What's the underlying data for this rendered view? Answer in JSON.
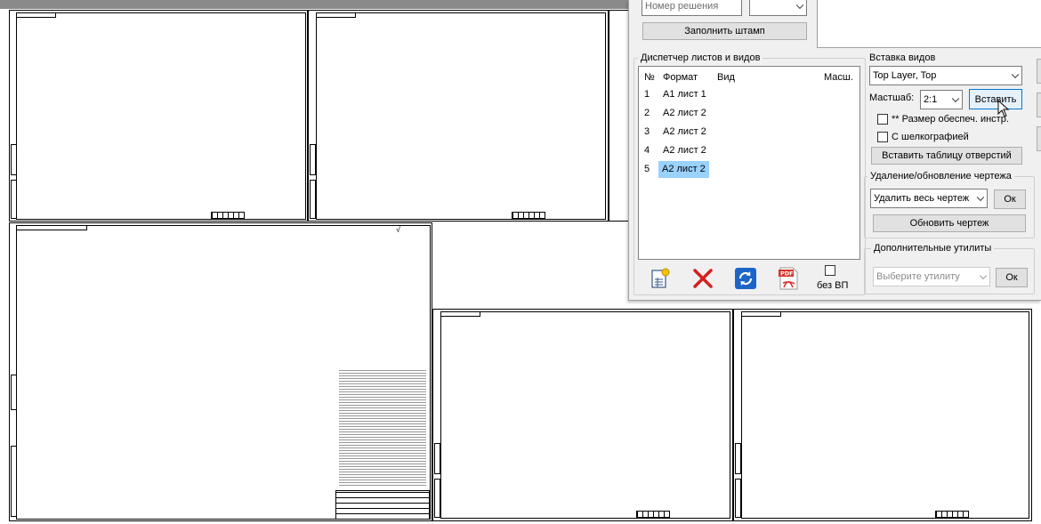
{
  "panel": {
    "top": {
      "decision_placeholder": "Номер решения",
      "fill_stamp_button": "Заполнить штамп"
    },
    "dispatcher": {
      "title": "Диспетчер листов и видов",
      "columns": [
        "№",
        "Формат",
        "Вид",
        "Масш."
      ],
      "rows": [
        {
          "num": "1",
          "format": "А1 лист 1"
        },
        {
          "num": "2",
          "format": "А2 лист 2"
        },
        {
          "num": "3",
          "format": "А2 лист 2"
        },
        {
          "num": "4",
          "format": "А2 лист 2"
        },
        {
          "num": "5",
          "format": "А2 лист 2",
          "selected": true
        }
      ],
      "toolbar": {
        "add_icon": "add-sheet-icon",
        "delete_icon": "delete-x-icon",
        "refresh_icon": "refresh-icon",
        "pdf_icon": "pdf-icon",
        "pdf_icon_text": "PDF",
        "no_vp_label": "без ВП"
      }
    },
    "insert_views": {
      "title": "Вставка видов",
      "layer_value": "Top Layer, Top",
      "scale_label": "Мастшаб:",
      "scale_value": "2:1",
      "insert_button": "Вставить",
      "tool_size_label": "** Размер обеспеч. инстр.",
      "silkscreen_label": "С шелкографией",
      "holes_table_button": "Вставить таблицу отверстий"
    },
    "delete_update": {
      "title": "Удаление/обновление чертежа",
      "delete_value": "Удалить весь чертеж",
      "ok_button": "Ок",
      "update_button": "Обновить чертеж"
    },
    "utilities": {
      "title": "Дополнительные утилиты",
      "placeholder": "Выберите утилиту",
      "ok_button": "Ок"
    }
  },
  "colors": {
    "selection": "#99d1ff",
    "panel_bg": "#f0f0f0",
    "delete_red": "#d42020",
    "refresh_blue": "#1c64c8",
    "pdf_red": "#d9332a"
  }
}
